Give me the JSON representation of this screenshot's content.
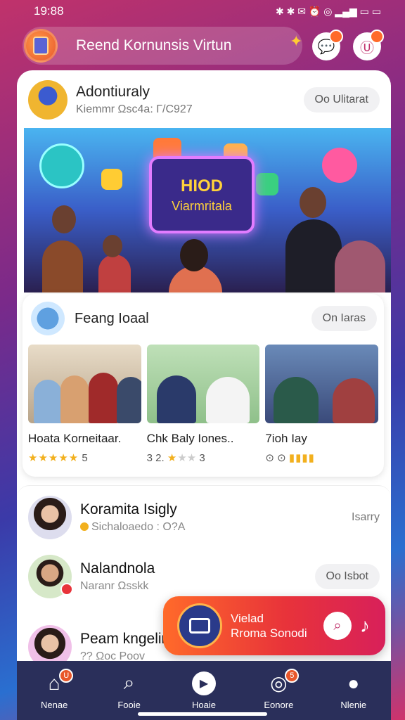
{
  "status_bar": {
    "time": "19:88",
    "icons": "✱ ✱ ✉ ⏰ ◎ ▂▄▆ ▭ ▭"
  },
  "header": {
    "title": "Reend Kornunsis Virtun",
    "icons": [
      "app-logo",
      "chat-bubble-icon",
      "profile-icon"
    ],
    "badges": [
      "",
      ""
    ]
  },
  "post": {
    "author": "Adontiuraly",
    "subtitle": "Kiemmr Ωsc4a: Γ/C927",
    "action": "Oo Ulitarat",
    "hero": {
      "line1": "HIOD",
      "line2": "Viarmritala"
    }
  },
  "group": {
    "title": "Feang Ioaal",
    "action": "On Iaras",
    "items": [
      {
        "title": "Hoata Korneitaar.",
        "stars": "★★★★★",
        "dim": "",
        "score": "5"
      },
      {
        "title": "Chk Baly Iones..",
        "stars": "★",
        "dim": "★★",
        "score": "3",
        "prefix": "3 2."
      },
      {
        "title": "7ioh Iay",
        "stars": "",
        "dim": "",
        "score": "",
        "prefix": "⊙ ⊙"
      }
    ]
  },
  "list": [
    {
      "name": "Koramita Isigly",
      "sub": "Sichaloaedo : Ο?Α",
      "right": "Isarry"
    },
    {
      "name": "Nalandnola",
      "sub": "Naranr Ωsskk",
      "right": "Oo Isbot"
    },
    {
      "name": "Peam kngelin",
      "sub": "?? Ωoc Poov",
      "right": ""
    }
  ],
  "floating": {
    "line1": "Vielad",
    "line2": "Rroma Sonodi"
  },
  "nav": [
    {
      "label": "Nenae",
      "icon": "home-icon"
    },
    {
      "label": "Fooie",
      "icon": "search-icon"
    },
    {
      "label": "Hoaie",
      "icon": "play-icon"
    },
    {
      "label": "Eonore",
      "icon": "chat-icon"
    },
    {
      "label": "Nlenie",
      "icon": "profile-icon"
    }
  ],
  "nav_badges": {
    "home": "U",
    "chat": "5"
  },
  "colors": {
    "accent": "#e8333a",
    "nav_bg": "#2a2f5a",
    "star": "#f2b01e"
  }
}
